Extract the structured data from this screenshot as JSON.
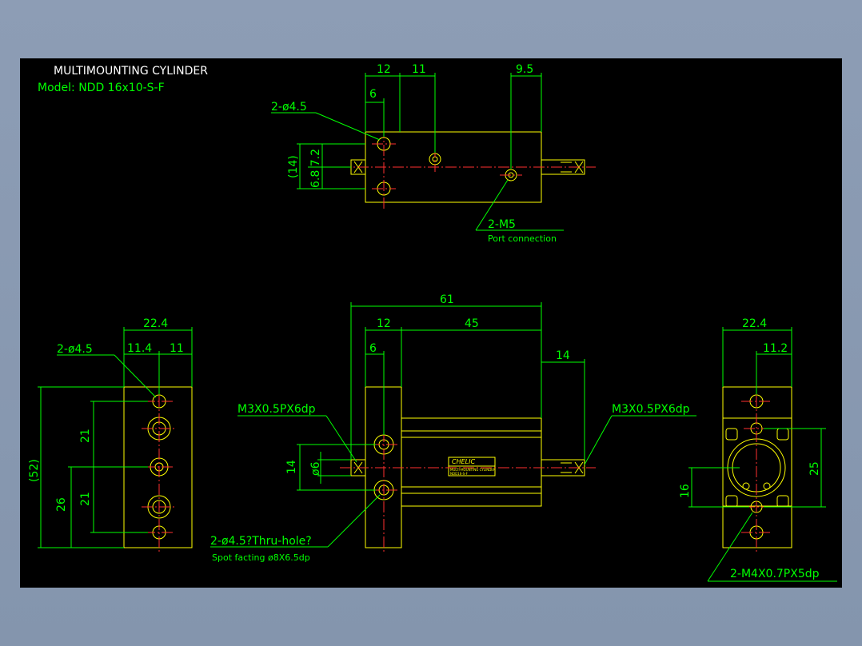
{
  "drawing": {
    "title": "MULTIMOUNTING CYLINDER",
    "model": "Model: NDD 16x10-S-F"
  },
  "top_view": {
    "dim_12": "12",
    "dim_11": "11",
    "dim_9_5": "9.5",
    "dim_6": "6",
    "dim_14p": "(14)",
    "dim_6_8_7_2": "6.8 7.2",
    "hole_callout": "2-ø4.5",
    "port_callout": "2-M5",
    "port_note": "Port connection"
  },
  "front_view": {
    "dim_61": "61",
    "dim_12": "12",
    "dim_45": "45",
    "dim_6": "6",
    "dim_14r": "14",
    "dim_14l": "14",
    "dim_o6": "ø6",
    "thread_left": "M3X0.5PX6dp",
    "thread_right": "M3X0.5PX6dp",
    "hole_callout": "2-ø4.5?Thru-hole?",
    "spot_facing": "Spot facting  ø8X6.5dp",
    "label_brand": "CHELIC",
    "label_line1": "MULTI-MOUNTING CYLINDER",
    "label_line2": "NDD16-S-F"
  },
  "left_view": {
    "dim_22_4": "22.4",
    "dim_11_4": "11.4",
    "dim_11": "11",
    "hole_callout": "2-ø4.5",
    "dim_52p": "(52)",
    "dim_21a": "21",
    "dim_21b": "21",
    "dim_26": "26"
  },
  "right_view": {
    "dim_22_4": "22.4",
    "dim_11_2": "11.2",
    "dim_25": "25",
    "dim_16": "16",
    "thread_callout": "2-M4X0.7PX5dp"
  },
  "colors": {
    "background": "#000000",
    "outline": "#ffff00",
    "dimension": "#00ff00",
    "centerline": "#ff3030",
    "frame": "#8d9db5"
  }
}
